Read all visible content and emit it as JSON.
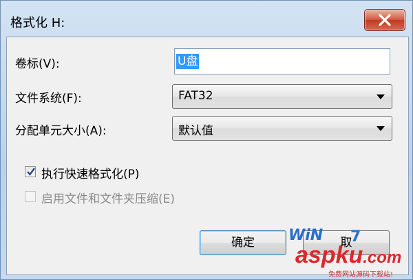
{
  "window": {
    "title": "格式化 H:"
  },
  "volume_label": {
    "label": "卷标(V):",
    "value": "U盘"
  },
  "file_system": {
    "label": "文件系统(F):",
    "selected": "FAT32"
  },
  "allocation_unit": {
    "label": "分配单元大小(A):",
    "selected": "默认值"
  },
  "quick_format": {
    "label": "执行快速格式化(P)",
    "checked": true
  },
  "enable_compression": {
    "label": "启用文件和文件夹压缩(E)",
    "checked": false,
    "disabled": true
  },
  "buttons": {
    "ok": "确定",
    "cancel": "取"
  },
  "watermark": {
    "brand_top": "WiN",
    "brand_seven": "7",
    "site_main": "aspku",
    "site_tld": ".com",
    "site_sub": "免费网站源码下载站!"
  },
  "colors": {
    "accent_select": "#3399ff",
    "close_red": "#c13c24",
    "watermark_red": "#e0262a",
    "watermark_blue": "#2a6fc9"
  }
}
